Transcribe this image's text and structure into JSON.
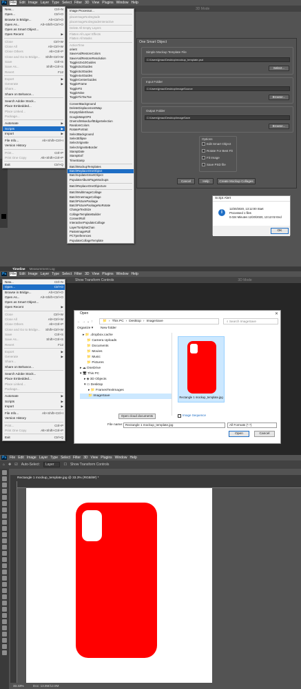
{
  "app": {
    "name": "Ps"
  },
  "colors": {
    "accent": "#1e6ec5",
    "phone_red": "#ff0000"
  },
  "panel1": {
    "menubar": [
      "File",
      "Edit",
      "Image",
      "Layer",
      "Type",
      "Select",
      "Filter",
      "3D",
      "View",
      "Plugins",
      "Window",
      "Help"
    ],
    "options": {
      "mode": "3D Mode"
    },
    "file_menu": [
      {
        "label": "New...",
        "shortcut": "Ctrl+N"
      },
      {
        "label": "Open...",
        "shortcut": "Ctrl+O"
      },
      {
        "label": "Browse in Bridge...",
        "shortcut": "Alt+Ctrl+O"
      },
      {
        "label": "Open As...",
        "shortcut": "Alt+Shift+Ctrl+O"
      },
      {
        "label": "Open as Smart Object...",
        "shortcut": ""
      },
      {
        "label": "Open Recent",
        "shortcut": "▶"
      },
      {
        "label": "Close",
        "shortcut": "Ctrl+W"
      },
      {
        "label": "Close All",
        "shortcut": "Alt+Ctrl+W"
      },
      {
        "label": "Close Others",
        "shortcut": "Alt+Ctrl+P"
      },
      {
        "label": "Close and Go to Bridge...",
        "shortcut": "Shift+Ctrl+W"
      },
      {
        "label": "Save",
        "shortcut": "Ctrl+S"
      },
      {
        "label": "Save As...",
        "shortcut": "Shift+Ctrl+S"
      },
      {
        "label": "Revert",
        "shortcut": "F12"
      },
      {
        "label": "Export",
        "shortcut": "▶"
      },
      {
        "label": "Generate",
        "shortcut": "▶"
      },
      {
        "label": "Share...",
        "shortcut": ""
      },
      {
        "label": "Share on Behance...",
        "shortcut": ""
      },
      {
        "label": "Search Adobe Stock...",
        "shortcut": ""
      },
      {
        "label": "Place Embedded...",
        "shortcut": ""
      },
      {
        "label": "Place Linked...",
        "shortcut": ""
      },
      {
        "label": "Package...",
        "shortcut": ""
      },
      {
        "label": "Automate",
        "shortcut": "▶"
      },
      {
        "label": "Scripts",
        "shortcut": "▶"
      },
      {
        "label": "Import",
        "shortcut": "▶"
      },
      {
        "label": "File Info...",
        "shortcut": "Alt+Shift+Ctrl+I"
      },
      {
        "label": "Version History",
        "shortcut": ""
      },
      {
        "label": "Print...",
        "shortcut": "Ctrl+P"
      },
      {
        "label": "Print One Copy",
        "shortcut": "Alt+Shift+Ctrl+P"
      },
      {
        "label": "Exit",
        "shortcut": "Ctrl+Q"
      }
    ],
    "scripts_menu": [
      "Image Processor...",
      "placeImageNoDegrade",
      "placeImageNoDegradeInteractive",
      "Delete All Empty Layers",
      "Flatten All Layer Effects",
      "Flatten All Masks",
      "ActionTime",
      "orient",
      "SaveAndRestoreColors",
      "SaveAndRestoreResolution",
      "Toggle10x10Guides",
      "Toggle2x2Guides",
      "Toggle3x3Guides",
      "Toggle4x4Guides",
      "ToggleCenterGuides",
      "ToggleFrame",
      "ToggleFS",
      "ToggleNine",
      "ToggleTicTacToe",
      "ConvertBackground",
      "DeleteDisplacementMap",
      "EmptySlideShows",
      "GoogleMapGPS",
      "OneInchMixedLeftEdgeSelection",
      "RandomColors",
      "RotatePortrait",
      "SelectBackground",
      "SelectEllipse",
      "SelectVignette",
      "SelectVignetteBorder",
      "StampDate",
      "StampExif",
      "TimeStamp",
      "BatchMockupTemplates",
      "BatchReplaceOneObject",
      "BatchUpdateSmartObject",
      "PopulateAlbumPageMockups",
      "BatchReplaceOneObjecture",
      "BatchMultiImageCollage",
      "BatchOneImageCollage",
      "BatchPicturePackage",
      "BatchPicturePackageNoRotate",
      "ChangeTextSize",
      "CollageTemplateBuilder",
      "ConvertRoll",
      "InteractivePopulateCollage",
      "LayerToAlphaChan",
      "PasteImageRoll",
      "PCTpreferences",
      "PopulateCollageTemplate"
    ],
    "dialog": {
      "title": "One Smart Object",
      "template_group": "Simple Mockup Template File",
      "template_path": "C:\\Users\\jjmac\\Desktop\\mockup_template.psd",
      "select_btn": "Select...",
      "input_group": "Input Folder",
      "input_path": "C:\\Users\\jjmac\\Desktop\\ImageSource",
      "browse_btn": "Browse...",
      "output_group": "Output Folder",
      "output_path": "C:\\Users\\jjmac\\Desktop\\ImageSave",
      "browse2_btn": "Browse...",
      "options_group": "Options",
      "opts": [
        "Edit Smart Object",
        "Rotate For Best Fit",
        "Fit Image",
        "Save PSD file"
      ],
      "cancel": "Cancel",
      "help": "Help",
      "create": "Create Mockup Collages"
    },
    "alert": {
      "title": "Script Alert",
      "line1": "12/20/2020, 13:12:00 Start",
      "line2": "Processed 1 files",
      "line3": "0.024 Minutes 12/20/2020, 13:12:02 End",
      "ok": "OK"
    },
    "tabs": [
      "Timeline",
      "Measurement Log"
    ]
  },
  "panel2": {
    "menubar": [
      "File",
      "Edit",
      "Image",
      "Layer",
      "Type",
      "Select",
      "Filter",
      "3D",
      "View",
      "Plugins",
      "Window",
      "Help"
    ],
    "options": {
      "transform": "Show Transform Controls",
      "mode": "3D Mode"
    },
    "file_menu": [
      {
        "label": "New...",
        "shortcut": "Ctrl+N"
      },
      {
        "label": "Open...",
        "shortcut": "Ctrl+O"
      },
      {
        "label": "Browse in Bridge...",
        "shortcut": "Alt+Ctrl+O"
      },
      {
        "label": "Open As...",
        "shortcut": "Alt+Shift+Ctrl+O"
      },
      {
        "label": "Open as Smart Object...",
        "shortcut": ""
      },
      {
        "label": "Open Recent",
        "shortcut": "▶"
      },
      {
        "label": "Close",
        "shortcut": "Ctrl+W"
      },
      {
        "label": "Close All",
        "shortcut": "Alt+Ctrl+W"
      },
      {
        "label": "Close Others",
        "shortcut": "Alt+Ctrl+P"
      },
      {
        "label": "Close and Go to Bridge...",
        "shortcut": "Shift+Ctrl+W"
      },
      {
        "label": "Save",
        "shortcut": "Ctrl+S"
      },
      {
        "label": "Save As...",
        "shortcut": "Shift+Ctrl+S"
      },
      {
        "label": "Revert",
        "shortcut": "F12"
      },
      {
        "label": "Export",
        "shortcut": "▶"
      },
      {
        "label": "Generate",
        "shortcut": "▶"
      },
      {
        "label": "Share...",
        "shortcut": ""
      },
      {
        "label": "Share on Behance...",
        "shortcut": ""
      },
      {
        "label": "Search Adobe Stock...",
        "shortcut": ""
      },
      {
        "label": "Place Embedded...",
        "shortcut": ""
      },
      {
        "label": "Place Linked...",
        "shortcut": ""
      },
      {
        "label": "Package...",
        "shortcut": ""
      },
      {
        "label": "Automate",
        "shortcut": "▶"
      },
      {
        "label": "Scripts",
        "shortcut": "▶"
      },
      {
        "label": "Import",
        "shortcut": "▶"
      },
      {
        "label": "File Info...",
        "shortcut": "Alt+Shift+Ctrl+I"
      },
      {
        "label": "Version History",
        "shortcut": ""
      },
      {
        "label": "Print...",
        "shortcut": "Ctrl+P"
      },
      {
        "label": "Print One Copy",
        "shortcut": "Alt+Shift+Ctrl+P"
      },
      {
        "label": "Exit",
        "shortcut": "Ctrl+Q"
      }
    ],
    "open_dialog": {
      "title": "Open",
      "path": [
        "This PC",
        "Desktop",
        "ImageSave"
      ],
      "search": "Search ImageSave",
      "organize": "Organize ▾",
      "new_folder": "New folder",
      "tree": [
        ".dropbox.cache",
        "Camera Uploads",
        "Documents",
        "Movies",
        "Music",
        "Pictures",
        "OneDrive",
        "This PC",
        "3D Objects",
        "Desktop",
        "FramesTextImages",
        "ImageSave"
      ],
      "file_caption": "Rectangle 1 mockup_template.jpg",
      "cloud_btn": "Open cloud documents",
      "image_sequence": "Image Sequence",
      "filename_label": "File name:",
      "filename": "Rectangle 1 mockup_template.jpg",
      "filter": "All Formats (*.*)",
      "open": "Open",
      "cancel": "Cancel"
    }
  },
  "panel3": {
    "menubar": [
      "File",
      "Edit",
      "Image",
      "Layer",
      "Type",
      "Select",
      "Filter",
      "3D",
      "View",
      "Plugins",
      "Window",
      "Help"
    ],
    "options": {
      "auto_select": "Auto-Select:",
      "layer": "Layer",
      "transform": "Show Transform Controls"
    },
    "doc_tab": "Rectangle 1 mockup_template.jpg @ 33.3% (RGB/8#) *",
    "status": {
      "zoom": "33.33%",
      "doc": "Doc: 13.8M/12.9M"
    }
  }
}
